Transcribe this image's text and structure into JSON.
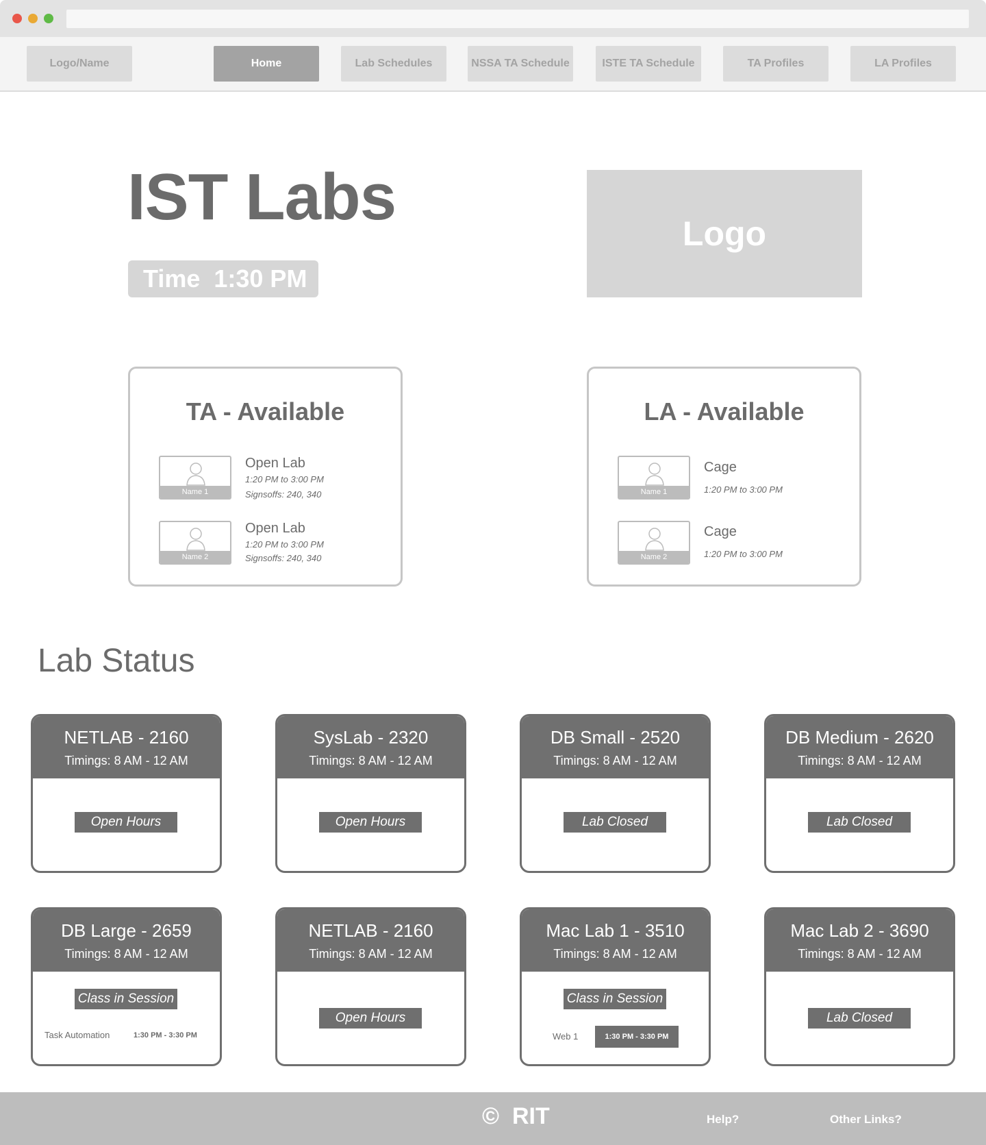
{
  "nav": {
    "logo": "Logo/Name",
    "items": [
      "Home",
      "Lab Schedules",
      "NSSA TA Schedule",
      "ISTE TA Schedule",
      "TA Profiles",
      "LA Profiles"
    ]
  },
  "hero": {
    "title": "IST Labs",
    "time_label": "Time  1:30 PM",
    "logo_label": "Logo"
  },
  "ta": {
    "title": "TA - Available",
    "people": [
      {
        "name": "Name 1",
        "role": "Open Lab",
        "time": "1:20 PM to 3:00 PM",
        "extra": "Signsoffs: 240, 340"
      },
      {
        "name": "Name 2",
        "role": "Open Lab",
        "time": "1:20 PM to 3:00 PM",
        "extra": "Signsoffs: 240, 340"
      }
    ]
  },
  "la": {
    "title": "LA - Available",
    "people": [
      {
        "name": "Name 1",
        "role": "Cage",
        "time": "1:20 PM to 3:00 PM"
      },
      {
        "name": "Name 2",
        "role": "Cage",
        "time": "1:20 PM to 3:00 PM"
      }
    ]
  },
  "lab_status": {
    "title": "Lab Status",
    "labs": [
      {
        "name": "NETLAB - 2160",
        "timings": "Timings: 8 AM - 12 AM",
        "status": "Open Hours"
      },
      {
        "name": "SysLab - 2320",
        "timings": "Timings: 8 AM - 12 AM",
        "status": "Open Hours"
      },
      {
        "name": "DB Small - 2520",
        "timings": "Timings: 8 AM - 12 AM",
        "status": "Lab Closed"
      },
      {
        "name": "DB Medium - 2620",
        "timings": "Timings: 8 AM - 12 AM",
        "status": "Lab Closed"
      },
      {
        "name": "DB Large - 2659",
        "timings": "Timings: 8 AM - 12 AM",
        "status": "Class in Session",
        "class_name": "Task Automation",
        "class_time": "1:30 PM - 3:30 PM"
      },
      {
        "name": "NETLAB - 2160",
        "timings": "Timings: 8 AM - 12 AM",
        "status": "Open Hours"
      },
      {
        "name": "Mac Lab 1 - 3510",
        "timings": "Timings: 8 AM - 12 AM",
        "status": "Class in Session",
        "class_name": "Web 1",
        "class_time": "1:30 PM - 3:30 PM"
      },
      {
        "name": "Mac Lab 2 - 3690",
        "timings": "Timings: 8 AM - 12 AM",
        "status": "Lab Closed"
      }
    ]
  },
  "footer": {
    "copyright": "©  RIT",
    "help": "Help?",
    "other": "Other Links?"
  },
  "colors": {
    "header_dark": "#707070",
    "pill_light": "#d6d6d6",
    "nav_active": "#a3a3a3",
    "footer": "#bdbdbd"
  }
}
